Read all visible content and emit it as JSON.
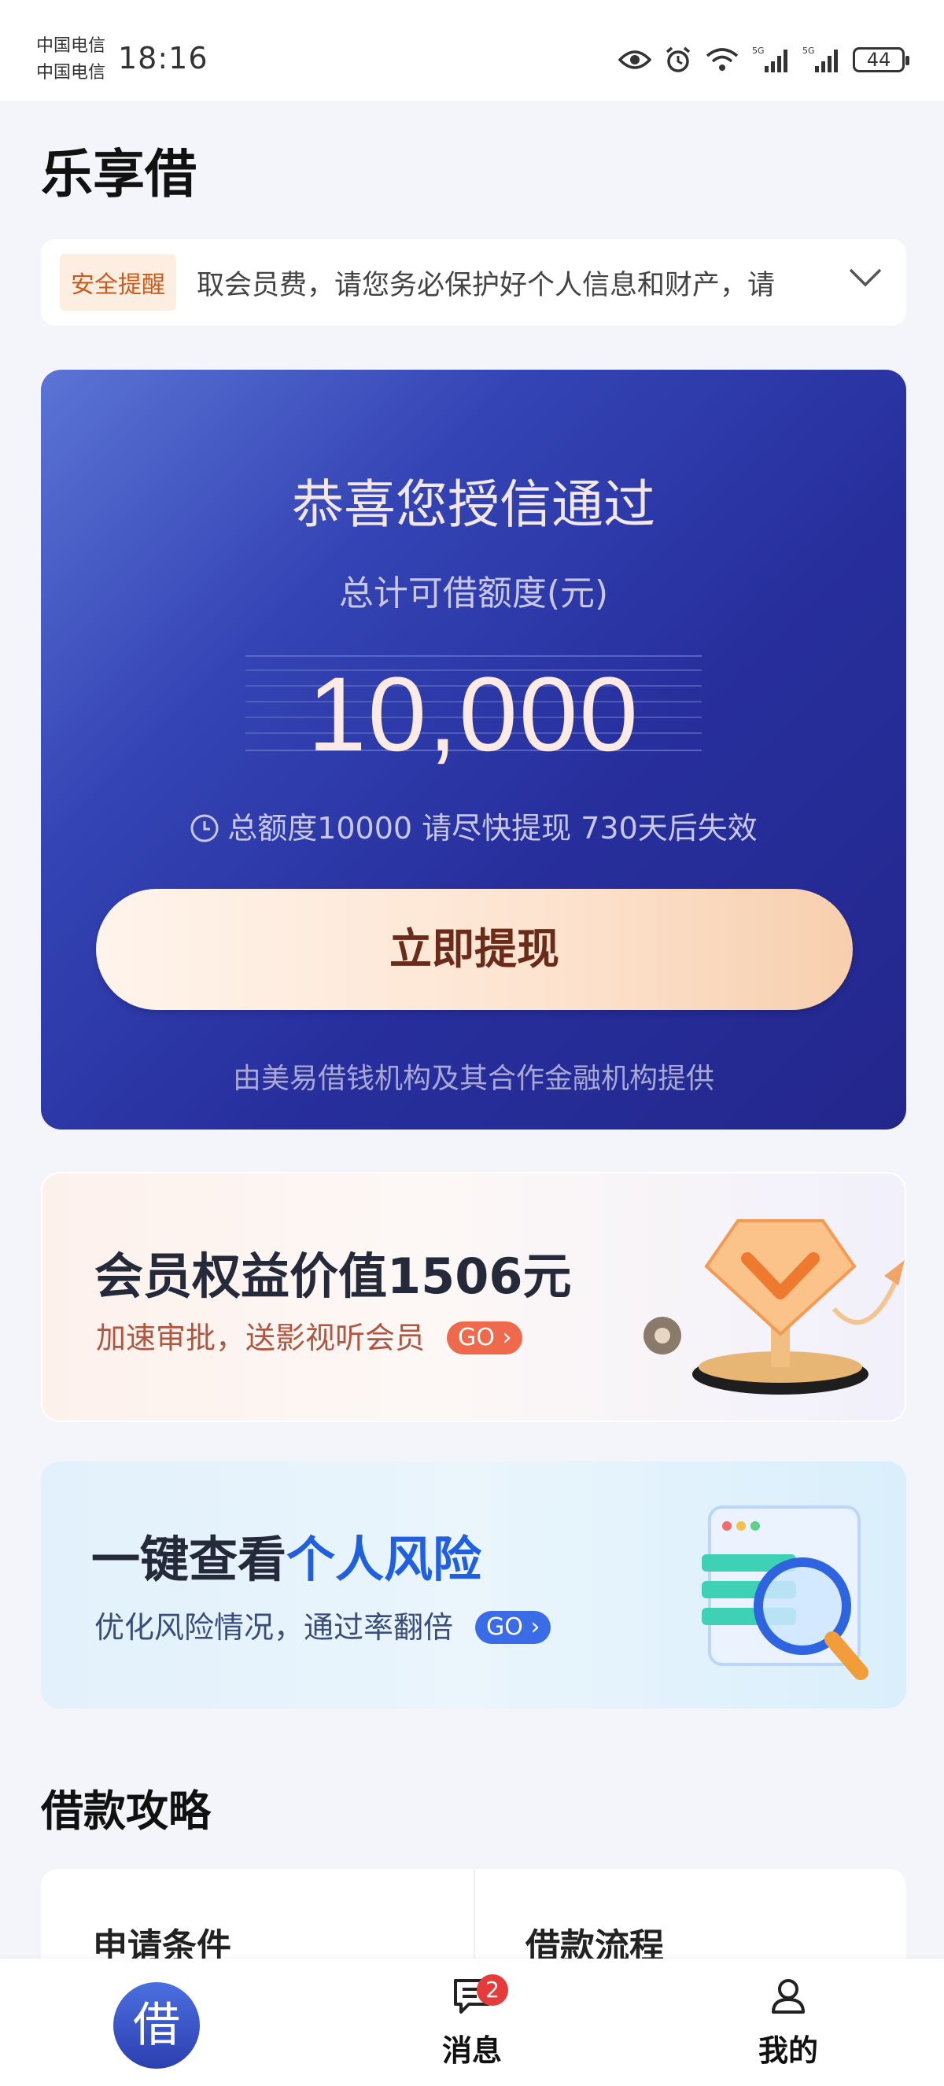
{
  "status_bar": {
    "carrier_1": "中国电信",
    "carrier_2": "中国电信",
    "time": "18:16",
    "battery": "44",
    "network_1": "5G",
    "network_2": "5G"
  },
  "app": {
    "title": "乐享借"
  },
  "security": {
    "tag": "安全提醒",
    "text": "取会员费，请您务必保护好个人信息和财产，请"
  },
  "credit": {
    "heading": "恭喜您授信通过",
    "subheading": "总计可借额度(元)",
    "amount": "10,000",
    "expiry_note": "总额度10000 请尽快提现 730天后失效",
    "withdraw_button": "立即提现",
    "provider_note": "由美易借钱机构及其合作金融机构提供"
  },
  "membership": {
    "title": "会员权益价值1506元",
    "subtitle": "加速审批，送影视听会员",
    "go_label": "GO"
  },
  "risk": {
    "title_prefix": "一键查看",
    "title_highlight": "个人风险",
    "subtitle": "优化风险情况，通过率翻倍",
    "go_label": "GO"
  },
  "guide": {
    "title": "借款攻略",
    "items": [
      "申请条件",
      "借款流程"
    ]
  },
  "bottom_nav": {
    "borrow_label": "借",
    "messages_label": "消息",
    "messages_badge": "2",
    "mine_label": "我的"
  },
  "colors": {
    "card_gradient_start": "#5b74d6",
    "card_gradient_end": "#23278c",
    "accent_blue": "#1f5fe0",
    "security_tag": "#c95b1f",
    "badge_red": "#e63b3b"
  }
}
